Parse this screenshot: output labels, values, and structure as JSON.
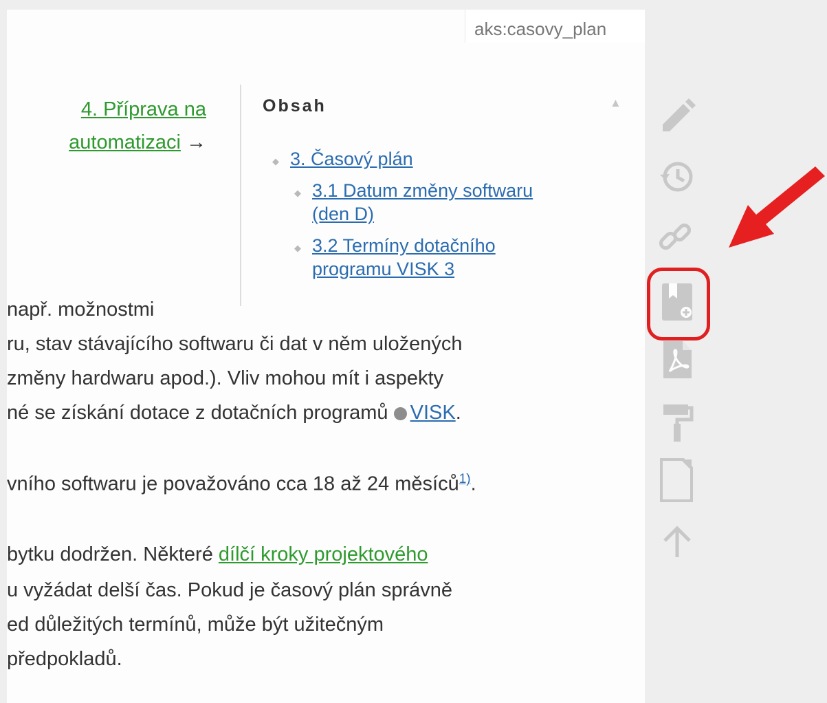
{
  "page": {
    "pagename": "aks:casovy_plan"
  },
  "nav": {
    "next_link_line1": "4. Příprava na",
    "next_link_line2": "automatizaci",
    "next_arrow": "→"
  },
  "toc": {
    "title": "Obsah",
    "collapse_icon": "▲",
    "items": [
      {
        "label": "3. Časový plán"
      },
      {
        "label_line1": "3.1 Datum změny softwaru",
        "label_line2": "(den D)"
      },
      {
        "label_line1": "3.2 Termíny dotačního",
        "label_line2": "programu VISK 3"
      }
    ]
  },
  "content": {
    "line1": "např. možnostmi",
    "line2": "ru, stav stávajícího softwaru či dat v něm uložených",
    "line3": "změny hardwaru apod.). Vliv mohou mít i aspekty",
    "line4_pre": "né se získání dotace z dotačních programů ",
    "line4_link": "VISK",
    "line4_post": ".",
    "line5_pre": "vního softwaru je považováno cca 18 až 24 měsíců",
    "line5_footnote": "1)",
    "line5_post": ".",
    "line6_pre": "bytku dodržen. Některé ",
    "line6_link": "dílčí kroky projektového",
    "line7": "u vyžádat delší čas. Pokud je časový plán správně",
    "line8": "ed důležitých termínů, může být užitečným",
    "line9": " předpokladů."
  },
  "tools": [
    {
      "name": "edit-icon"
    },
    {
      "name": "history-icon"
    },
    {
      "name": "link-icon"
    },
    {
      "name": "bookmark-add-icon"
    },
    {
      "name": "pdf-icon"
    },
    {
      "name": "paint-roller-icon"
    },
    {
      "name": "page-icon"
    },
    {
      "name": "arrow-up-icon"
    }
  ],
  "colors": {
    "accent_link": "#2b6cb0",
    "internal_link": "#2e9a2e",
    "highlight": "#e02020",
    "icon_gray": "#c8c8c8"
  }
}
